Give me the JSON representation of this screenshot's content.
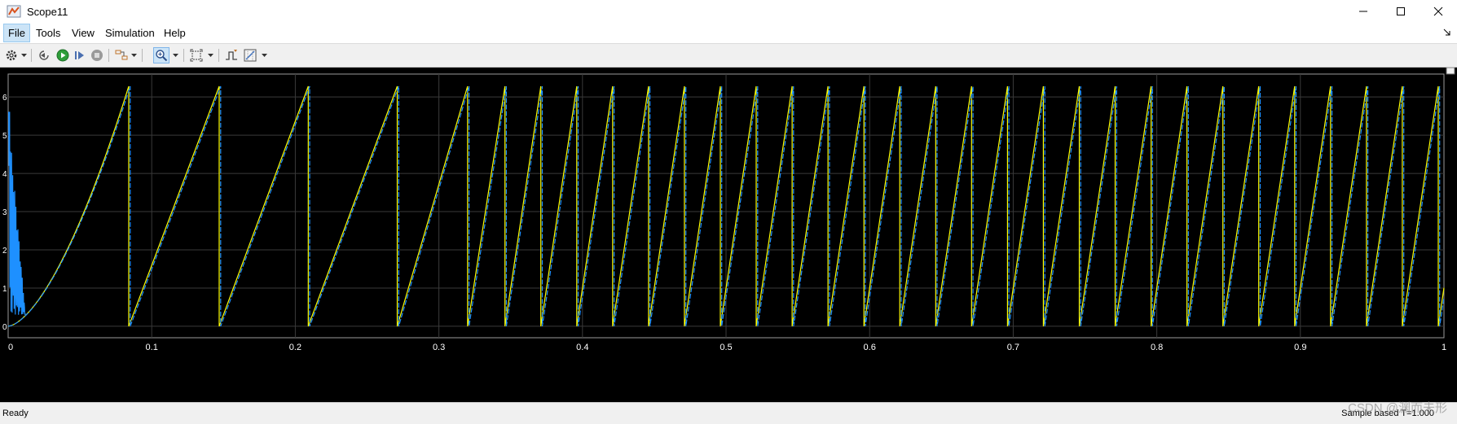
{
  "window": {
    "title": "Scope11"
  },
  "menu": {
    "items": [
      {
        "id": "file",
        "label": "File",
        "active": true
      },
      {
        "id": "tools",
        "label": "Tools",
        "active": false
      },
      {
        "id": "view",
        "label": "View",
        "active": false
      },
      {
        "id": "simulation",
        "label": "Simulation",
        "active": false
      },
      {
        "id": "help",
        "label": "Help",
        "active": false
      }
    ]
  },
  "toolbar": {
    "buttons": [
      {
        "name": "configuration-icon",
        "dropdown": true
      },
      {
        "name": "step-back-icon",
        "dropdown": false
      },
      {
        "name": "run-icon",
        "dropdown": false
      },
      {
        "name": "step-forward-icon",
        "dropdown": false
      },
      {
        "name": "stop-icon",
        "dropdown": false
      },
      {
        "name": "highlight-simulink-block-icon",
        "dropdown": true
      },
      {
        "name": "zoom-in-icon",
        "dropdown": true,
        "pressed": true
      },
      {
        "name": "autoscale-icon",
        "dropdown": true
      },
      {
        "name": "triggers-icon",
        "dropdown": false
      },
      {
        "name": "cursor-measurements-icon",
        "dropdown": true
      }
    ]
  },
  "colors": {
    "plot_background": "#000000",
    "grid": "#3a3a3a",
    "axis_text": "#ffffff",
    "series_yellow": "#ffff00",
    "series_blue": "#1e90ff",
    "series_cyan": "#7fd6ff"
  },
  "chart_data": {
    "type": "line",
    "xlim": [
      0,
      1
    ],
    "ylim": [
      -0.3,
      6.6
    ],
    "x_ticks": [
      "0",
      "0.1",
      "0.2",
      "0.3",
      "0.4",
      "0.5",
      "0.6",
      "0.7",
      "0.8",
      "0.9",
      "1"
    ],
    "y_ticks": [
      "0",
      "1",
      "2",
      "3",
      "4",
      "5",
      "6"
    ],
    "grid": true,
    "series": [
      {
        "color": "#ffff00",
        "reset_times": [
          0.0,
          0.084,
          0.147,
          0.209,
          0.271,
          0.32,
          0.346,
          0.371,
          0.396,
          0.421,
          0.446,
          0.471,
          0.496,
          0.521,
          0.546,
          0.571,
          0.596,
          0.621,
          0.646,
          0.671,
          0.696,
          0.721,
          0.746,
          0.771,
          0.796,
          0.821,
          0.846,
          0.871,
          0.896,
          0.921,
          0.946,
          0.971,
          0.996
        ],
        "peak": 6.28
      },
      {
        "color": "#1e90ff",
        "reset_times": [
          0.0,
          0.085,
          0.148,
          0.21,
          0.272,
          0.321,
          0.347,
          0.372,
          0.397,
          0.422,
          0.447,
          0.472,
          0.497,
          0.522,
          0.547,
          0.572,
          0.597,
          0.622,
          0.647,
          0.672,
          0.697,
          0.722,
          0.747,
          0.772,
          0.797,
          0.822,
          0.847,
          0.872,
          0.897,
          0.922,
          0.947,
          0.972,
          0.997
        ],
        "peak": 6.28,
        "startup_oscillation": {
          "t_end": 0.012,
          "max": 5.6,
          "min": 0.3
        }
      }
    ]
  },
  "status": {
    "left": "Ready",
    "right": "Sample based  T=1.000"
  },
  "watermark": "CSDN @渊而未形"
}
